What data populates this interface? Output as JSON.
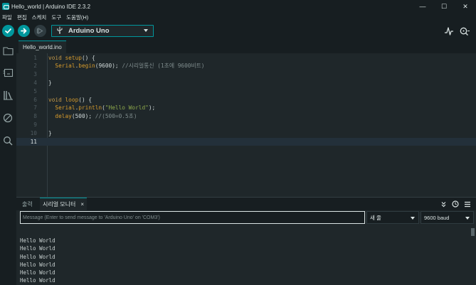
{
  "window": {
    "title": "Hello_world | Arduino IDE 2.3.2",
    "minimize": "—",
    "maximize": "☐",
    "close": "✕"
  },
  "menu": [
    "파일",
    "편집",
    "스케치",
    "도구",
    "도움말(H)"
  ],
  "toolbar": {
    "board": "Arduino Uno"
  },
  "tabs": [
    {
      "label": "Hello_world.ino"
    }
  ],
  "editor": {
    "current_line": 11,
    "lines": [
      {
        "n": "1",
        "tokens": [
          [
            "kw",
            "void"
          ],
          [
            "t",
            " "
          ],
          [
            "fn",
            "setup"
          ],
          [
            "t",
            "() {"
          ]
        ]
      },
      {
        "n": "2",
        "tokens": [
          [
            "t",
            "  "
          ],
          [
            "fn",
            "Serial"
          ],
          [
            "t",
            "."
          ],
          [
            "fn",
            "begin"
          ],
          [
            "t",
            "(9600); "
          ],
          [
            "cm",
            "//시리얼통신 (1초에 9600비트)"
          ]
        ]
      },
      {
        "n": "3",
        "tokens": []
      },
      {
        "n": "4",
        "tokens": [
          [
            "t",
            "}"
          ]
        ]
      },
      {
        "n": "5",
        "tokens": []
      },
      {
        "n": "6",
        "tokens": [
          [
            "kw",
            "void"
          ],
          [
            "t",
            " "
          ],
          [
            "fn",
            "loop"
          ],
          [
            "t",
            "() {"
          ]
        ]
      },
      {
        "n": "7",
        "tokens": [
          [
            "t",
            "  "
          ],
          [
            "fn",
            "Serial"
          ],
          [
            "t",
            "."
          ],
          [
            "fn",
            "println"
          ],
          [
            "t",
            "("
          ],
          [
            "str",
            "\"Hello World\""
          ],
          [
            "t",
            ");"
          ]
        ]
      },
      {
        "n": "8",
        "tokens": [
          [
            "t",
            "  "
          ],
          [
            "fn",
            "delay"
          ],
          [
            "t",
            "(500); "
          ],
          [
            "cm",
            "//(500=0.5초)"
          ]
        ]
      },
      {
        "n": "9",
        "tokens": []
      },
      {
        "n": "10",
        "tokens": [
          [
            "t",
            "}"
          ]
        ]
      },
      {
        "n": "11",
        "tokens": []
      }
    ]
  },
  "panel": {
    "output_tab": "출력",
    "monitor_tab": "시리얼 모니터",
    "close": "×",
    "message_placeholder": "Message (Enter to send message to 'Arduino Uno' on 'COM3')",
    "line_ending": "새 줄",
    "baud": "9600 baud",
    "serial_lines": [
      "Hello World",
      "Hello World",
      "Hello World",
      "Hello World",
      "Hello World",
      "Hello World"
    ]
  },
  "colors": {
    "accent": "#00979d",
    "background": "#1f272a",
    "chrome": "#171e21"
  },
  "icons": {
    "verify": "check-icon",
    "upload": "arrow-right-icon",
    "debug": "debug-icon",
    "plotter": "serial-plotter-icon",
    "monitor": "serial-monitor-icon"
  }
}
